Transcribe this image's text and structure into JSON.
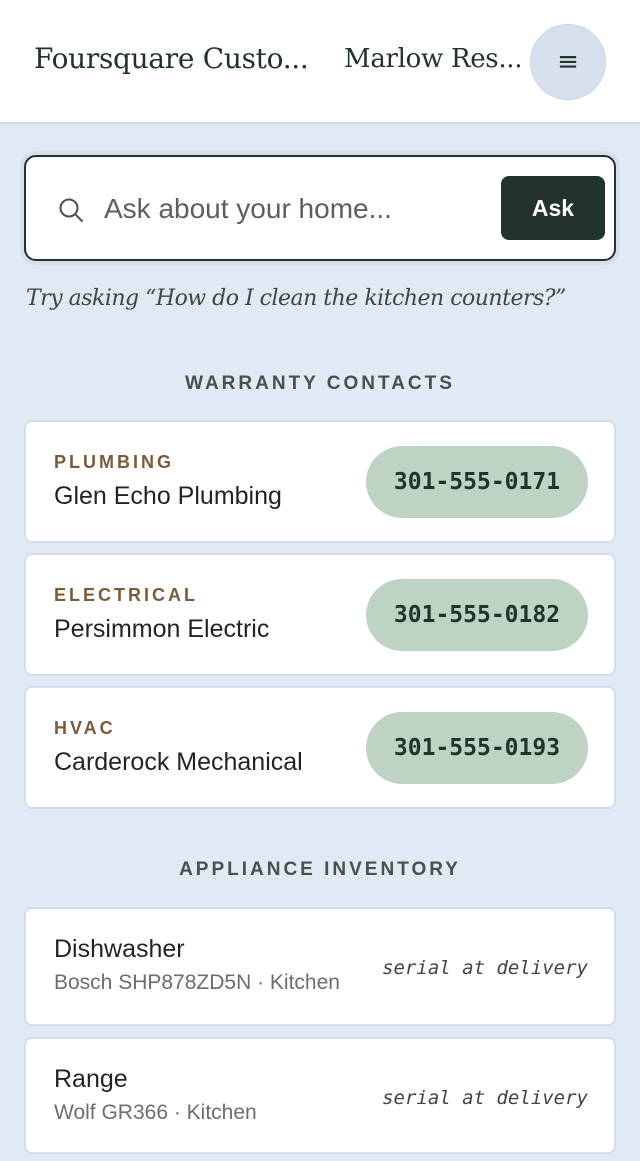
{
  "header": {
    "brand": "Foursquare Custo...",
    "home": "Marlow Res...",
    "menu_icon": "≡"
  },
  "search": {
    "placeholder": "Ask about your home...",
    "button": "Ask"
  },
  "hint": "Try asking “How do I clean the kitchen counters?”",
  "warranty": {
    "title": "WARRANTY CONTACTS",
    "contacts": [
      {
        "category": "PLUMBING",
        "name": "Glen Echo Plumbing",
        "phone": "301-555-0171"
      },
      {
        "category": "ELECTRICAL",
        "name": "Persimmon Electric",
        "phone": "301-555-0182"
      },
      {
        "category": "HVAC",
        "name": "Carderock Mechanical",
        "phone": "301-555-0193"
      }
    ]
  },
  "appliances": {
    "title": "APPLIANCE INVENTORY",
    "items": [
      {
        "name": "Dishwasher",
        "detail": "Bosch SHP878ZD5N · Kitchen",
        "serial": "serial at delivery"
      },
      {
        "name": "Range",
        "detail": "Wolf GR366 · Kitchen",
        "serial": "serial at delivery"
      }
    ]
  },
  "icons": {
    "search": "search-icon",
    "menu": "menu-icon"
  }
}
